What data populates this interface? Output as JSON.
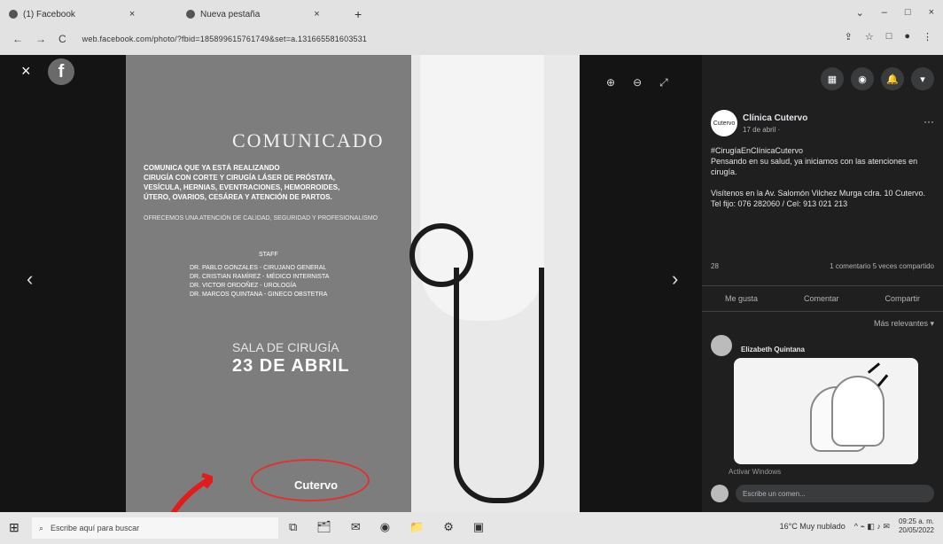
{
  "browser": {
    "tabs": [
      {
        "label": "(1) Facebook",
        "close": "×"
      },
      {
        "label": "Nueva pestaña",
        "close": "×"
      }
    ],
    "new_tab": "+",
    "window_controls": [
      "⌄",
      "–",
      "□",
      "×"
    ],
    "nav": {
      "back": "←",
      "forward": "→",
      "reload": "C"
    },
    "url": "web.facebook.com/photo/?fbid=185899615761749&set=a.131665581603531",
    "right_icons": [
      "⇪",
      "☆",
      "□",
      "●",
      "⋮"
    ]
  },
  "viewer": {
    "close": "×",
    "logo": "f",
    "prev": "‹",
    "next": "›",
    "tools": [
      "⊕",
      "⊖",
      "⤢"
    ]
  },
  "poster": {
    "title": "COMUNICADO",
    "body": [
      "COMUNICA QUE YA ESTÁ REALIZANDO",
      "CIRUGÍA CON CORTE Y CIRUGÍA LÁSER DE PRÓSTATA,",
      "VESÍCULA, HERNIAS, EVENTRACIONES, HEMORROIDES,",
      "ÚTERO, OVARIOS, CESÁREA Y ATENCIÓN DE PARTOS."
    ],
    "online": "OFRECEMOS UNA ATENCIÓN DE CALIDAD, SEGURIDAD Y PROFESIONALISMO",
    "staff_header": "STAFF",
    "staff": [
      "DR. PABLO GONZALES - CIRUJANO GENERAL",
      "DR. CRISTIAN RAMÍREZ - MÉDICO INTERNISTA",
      "DR. VICTOR ORDOÑEZ - UROLOGÍA",
      "DR. MARCOS QUINTANA - GINECO OBSTETRA"
    ],
    "date_line1": "SALA DE CIRUGÍA",
    "date_line2": "23 DE ABRIL",
    "brand": "Cutervo"
  },
  "panel": {
    "top_icons": [
      "▦",
      "◉",
      "🔔",
      "▾"
    ],
    "page_name": "Clínica Cutervo",
    "avatar_text": "Cutervo",
    "post_date": "17 de abril · ",
    "more": "···",
    "hashtag": "#CirugíaEnClínicaCutervo",
    "line1": "Pensando en su salud, ya iniciamos con las atenciones en cirugía.",
    "line2": "Visítenos en la Av. Salomón Vilchez Murga cdra. 10 Cutervo.",
    "line3": "Tel fijo: 076 282060 / Cel: 913 021 213",
    "reactions": "28",
    "counts": "1 comentario  5 veces compartido",
    "like": "Me gusta",
    "comment": "Comentar",
    "share": "Compartir",
    "sort": "Más relevantes ▾",
    "commenter": "Elizabeth Quintana",
    "composer_placeholder": "Escribe un comen...",
    "watermark": "Activar Windows"
  },
  "taskbar": {
    "start": "⊞",
    "search_placeholder": "Escribe aquí para buscar",
    "icons": [
      "⧉",
      "🗂",
      "✉",
      "◉",
      "📁",
      "⚙",
      "▣"
    ],
    "weather": "16°C Muy nublado",
    "time": "09:25 a. m.",
    "date": "20/05/2022"
  }
}
